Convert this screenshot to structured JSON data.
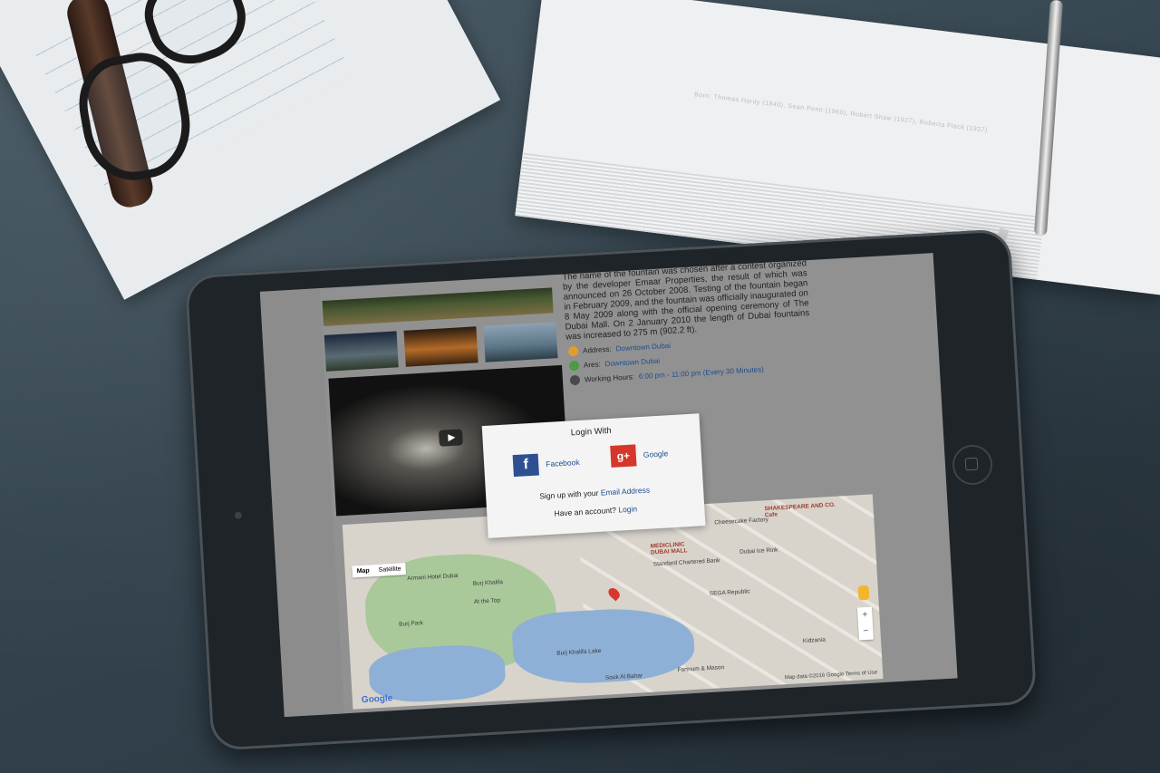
{
  "scene": {
    "description_icons": {
      "glasses": "eyeglasses-icon",
      "notebook": "notebook-icon",
      "pen": "pen-icon"
    }
  },
  "page": {
    "description": "The name of the fountain was chosen after a contest organized by the developer Emaar Properties, the result of which was announced on 26 October 2008. Testing of the fountain began in February 2009, and the fountain was officially inaugurated on 8 May 2009 along with the official opening ceremony of The Dubai Mall. On 2 January 2010 the length of Dubai fountains was increased to 275 m (902.2 ft).",
    "info": [
      {
        "label": "Address:",
        "value": "Downtown Dubai",
        "icon": "location-icon",
        "color": "#e59a2c"
      },
      {
        "label": "Ares:",
        "value": "Downtown Dubai",
        "icon": "area-icon",
        "color": "#4c9a44"
      },
      {
        "label": "Working Hours:",
        "value": "6:00 pm - 11:00 pm (Every 30 Minutes)",
        "icon": "clock-icon",
        "color": "#4a4a4a"
      }
    ]
  },
  "map": {
    "type_map": "Map",
    "type_satellite": "Satellite",
    "labels": [
      "Armani Hotel Dubai",
      "Burj Khalifa",
      "At the Top",
      "Burj Park",
      "Burj Khalifa Lake",
      "Souk Al Bahar",
      "Fortnum & Mason",
      "MEDICLINIC DUBAI MALL",
      "Standard Chartered Bank",
      "Dubai Ice Rink",
      "SEGA Republic",
      "Kidzania",
      "Cheesecake Factory",
      "SHAKESPEARE AND CO. Cafe"
    ],
    "logo": "Google",
    "footer": "Map data ©2016 Google   Terms of Use",
    "zoom_in": "+",
    "zoom_out": "−"
  },
  "modal": {
    "title": "Login With",
    "facebook": "Facebook",
    "google": "Google",
    "signup_prefix": "Sign up with your ",
    "signup_link": "Email Address",
    "account_prefix": "Have an account? ",
    "account_link": "Login"
  }
}
